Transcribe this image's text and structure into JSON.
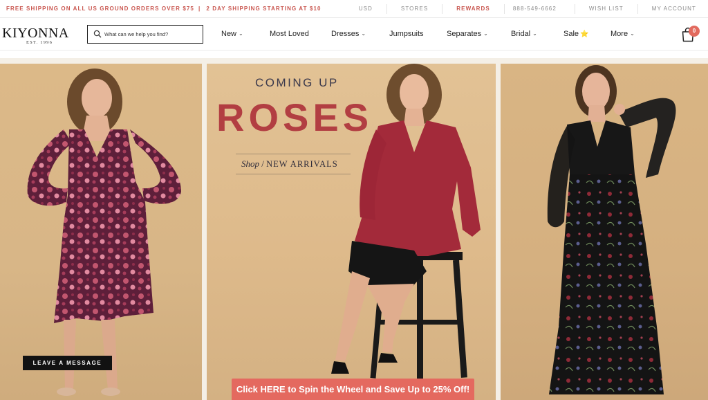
{
  "promo": {
    "left_text": "FREE SHIPPING ON ALL US GROUND ORDERS OVER $75",
    "separator": "|",
    "right_text": "2 DAY SHIPPING STARTING AT $10"
  },
  "utility_nav": {
    "currency": "USD",
    "stores": "STORES",
    "rewards": "REWARDS",
    "phone": "888-549-6662",
    "wishlist": "WISH LIST",
    "account": "MY ACCOUNT"
  },
  "brand": {
    "name": "KIYONNA",
    "established": "EST. 1996"
  },
  "search": {
    "placeholder": "What can we help you find?"
  },
  "main_nav": {
    "items": [
      {
        "label": "New",
        "has_dropdown": true
      },
      {
        "label": "Most Loved",
        "has_dropdown": false
      },
      {
        "label": "Dresses",
        "has_dropdown": true
      },
      {
        "label": "Jumpsuits",
        "has_dropdown": false
      },
      {
        "label": "Separates",
        "has_dropdown": true
      },
      {
        "label": "Bridal",
        "has_dropdown": true
      },
      {
        "label": "Sale",
        "has_dropdown": false,
        "icon": "star-icon"
      },
      {
        "label": "More",
        "has_dropdown": true
      }
    ],
    "chevron": "⌄",
    "star": "⭐"
  },
  "cart": {
    "count": "0"
  },
  "hero": {
    "eyebrow": "COMING UP",
    "headline": "ROSES",
    "shop_prefix": "Shop",
    "shop_separator": "/",
    "shop_link": "NEW ARRIVALS"
  },
  "leave_message": {
    "label": "LEAVE A MESSAGE"
  },
  "spin_banner": {
    "label": "Click HERE to Spin the Wheel and Save Up to 25% Off!"
  },
  "colors": {
    "accent": "#c9564f",
    "headline": "#b23e42",
    "spin_bg": "#e4695f",
    "badge": "#e26a5e"
  }
}
